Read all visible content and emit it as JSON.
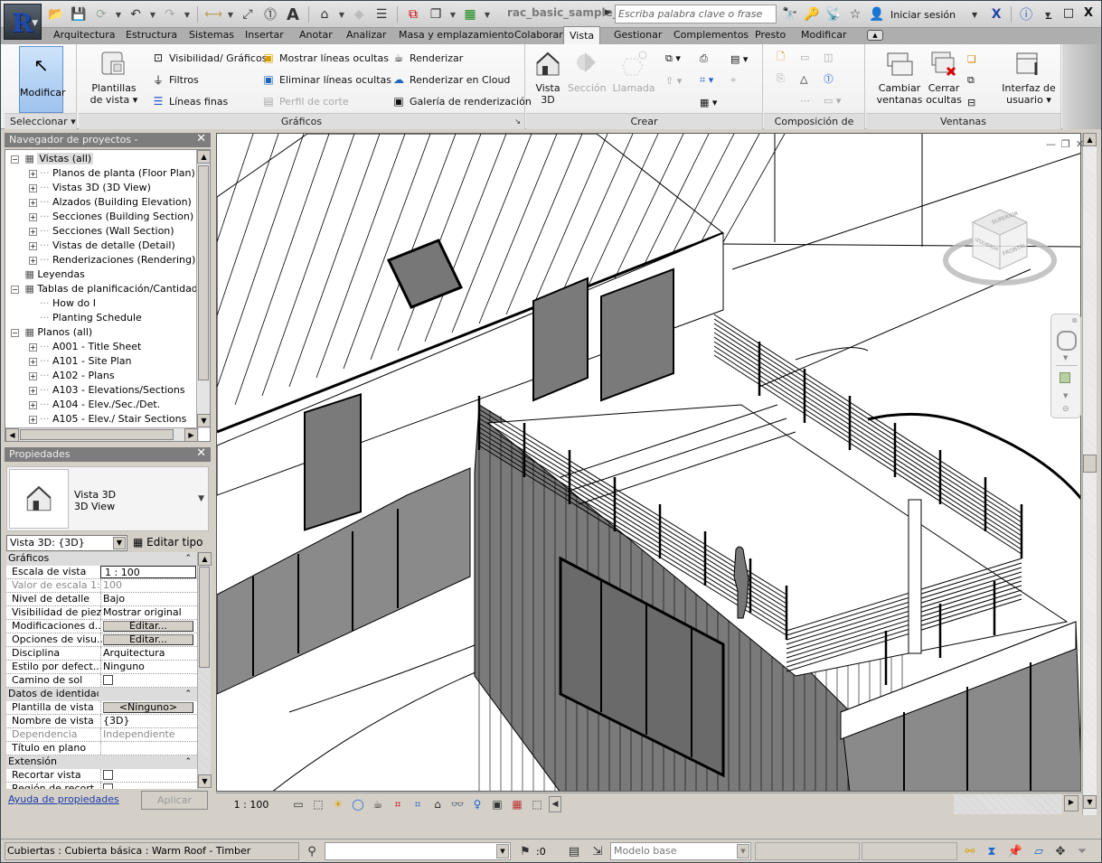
{
  "title_bar": {
    "doc_title": "rac_basic_sample_...",
    "search_placeholder": "Escriba palabra clave o frase",
    "login_label": "Iniciar sesión",
    "icons": [
      "open-icon",
      "save-icon",
      "sync-icon",
      "undo-icon",
      "redo-icon",
      "measure-icon",
      "dimension-icon",
      "tag-icon",
      "text-icon",
      "3d-view-icon",
      "section-icon",
      "thin-lines-icon",
      "close-hidden-icon",
      "switch-windows-icon",
      "customize-icon"
    ]
  },
  "tabs": [
    {
      "label": "Arquitectura"
    },
    {
      "label": "Estructura"
    },
    {
      "label": "Sistemas"
    },
    {
      "label": "Insertar"
    },
    {
      "label": "Anotar"
    },
    {
      "label": "Analizar"
    },
    {
      "label": "Masa y emplazamiento"
    },
    {
      "label": "Colaborar"
    },
    {
      "label": "Vista",
      "active": true
    },
    {
      "label": "Gestionar"
    },
    {
      "label": "Complementos"
    },
    {
      "label": "Presto"
    },
    {
      "label": "Modificar"
    }
  ],
  "ribbon": {
    "select": {
      "modify_label": "Modificar",
      "panel_label": "Seleccionar"
    },
    "graphics": {
      "panel_label": "Gráficos",
      "view_templates": "Plantillas de vista",
      "visibility": "Visibilidad/ Gráficos",
      "filters": "Filtros",
      "thin_lines": "Líneas finas",
      "show_hidden": "Mostrar líneas ocultas",
      "remove_hidden": "Eliminar líneas ocultas",
      "cut_profile": "Perfil de corte",
      "render": "Renderizar",
      "render_cloud": "Renderizar  en Cloud",
      "render_gallery": "Galería de  renderización"
    },
    "create": {
      "panel_label": "Crear",
      "view3d": "Vista 3D",
      "section": "Sección",
      "callout": "Llamada"
    },
    "sheet": {
      "panel_label": "Composición de plano"
    },
    "windows": {
      "panel_label": "Ventanas",
      "switch": "Cambiar ventanas",
      "close_hidden": "Cerrar ocultas"
    },
    "ui": {
      "label": "Interfaz de usuario"
    }
  },
  "project_browser": {
    "title": "Navegador de proyectos - rac_basic_s...",
    "items": [
      {
        "label": "Vistas (all)",
        "level": 0,
        "exp": "-",
        "selected": true
      },
      {
        "label": "Planos de planta (Floor Plan)",
        "level": 1,
        "exp": "+"
      },
      {
        "label": "Vistas 3D (3D View)",
        "level": 1,
        "exp": "+"
      },
      {
        "label": "Alzados (Building Elevation)",
        "level": 1,
        "exp": "+"
      },
      {
        "label": "Secciones (Building Section)",
        "level": 1,
        "exp": "+"
      },
      {
        "label": "Secciones (Wall Section)",
        "level": 1,
        "exp": "+"
      },
      {
        "label": "Vistas de detalle (Detail)",
        "level": 1,
        "exp": "+"
      },
      {
        "label": "Renderizaciones (Rendering)",
        "level": 1,
        "exp": "+"
      },
      {
        "label": "Leyendas",
        "level": 0,
        "exp": ""
      },
      {
        "label": "Tablas de planificación/Cantidad",
        "level": 0,
        "exp": "-"
      },
      {
        "label": "How do I",
        "level": 1,
        "exp": ""
      },
      {
        "label": "Planting Schedule",
        "level": 1,
        "exp": ""
      },
      {
        "label": "Planos (all)",
        "level": 0,
        "exp": "-"
      },
      {
        "label": "A001 - Title Sheet",
        "level": 1,
        "exp": "+"
      },
      {
        "label": "A101 - Site Plan",
        "level": 1,
        "exp": "+"
      },
      {
        "label": "A102 - Plans",
        "level": 1,
        "exp": "+"
      },
      {
        "label": "A103 - Elevations/Sections",
        "level": 1,
        "exp": "+"
      },
      {
        "label": "A104 - Elev./Sec./Det.",
        "level": 1,
        "exp": "+"
      },
      {
        "label": "A105 - Elev./ Stair Sections",
        "level": 1,
        "exp": "+"
      }
    ]
  },
  "properties": {
    "title": "Propiedades",
    "type_line1": "Vista 3D",
    "type_line2": "3D View",
    "instance_combo": "Vista 3D: {3D}",
    "edit_type": "Editar tipo",
    "rows": [
      {
        "cat": "Gráficos"
      },
      {
        "k": "Escala de vista",
        "v": "1 : 100",
        "box": true
      },
      {
        "k": "Valor de escala    1:",
        "v": "100",
        "dis": true
      },
      {
        "k": "Nivel de detalle",
        "v": "Bajo"
      },
      {
        "k": "Visibilidad de piezas",
        "v": "Mostrar original"
      },
      {
        "k": "Modificaciones d...",
        "btn": "Editar..."
      },
      {
        "k": "Opciones de visu...",
        "btn": "Editar..."
      },
      {
        "k": "Disciplina",
        "v": "Arquitectura"
      },
      {
        "k": "Estilo por defect...",
        "v": "Ninguno"
      },
      {
        "k": "Camino de sol",
        "check": false
      },
      {
        "cat": "Datos de identidad"
      },
      {
        "k": "Plantilla de vista",
        "btn": "<Ninguno>"
      },
      {
        "k": "Nombre de vista",
        "v": "{3D}"
      },
      {
        "k": "Dependencia",
        "v": "Independiente",
        "dis": true
      },
      {
        "k": "Título en plano",
        "v": ""
      },
      {
        "cat": "Extensión"
      },
      {
        "k": "Recortar vista",
        "check": false
      },
      {
        "k": "Región de recort...",
        "check": false
      }
    ],
    "help_link": "Ayuda de propiedades",
    "apply": "Aplicar"
  },
  "viewcube": {
    "top": "SUPERIOR",
    "front": "FRONTAL",
    "left": "IZQUIERDA"
  },
  "view_control": {
    "scale": "1 : 100"
  },
  "status_bar": {
    "message": "Cubiertas : Cubierta básica : Warm Roof - Timber",
    "selection_count": ":0",
    "model": "Modelo base"
  },
  "colors": {
    "accent": "#5d91cf",
    "panel_header": "#7d7d7d",
    "tab_bar": "#aeaeae",
    "model_dark": "#7a7a7a"
  }
}
